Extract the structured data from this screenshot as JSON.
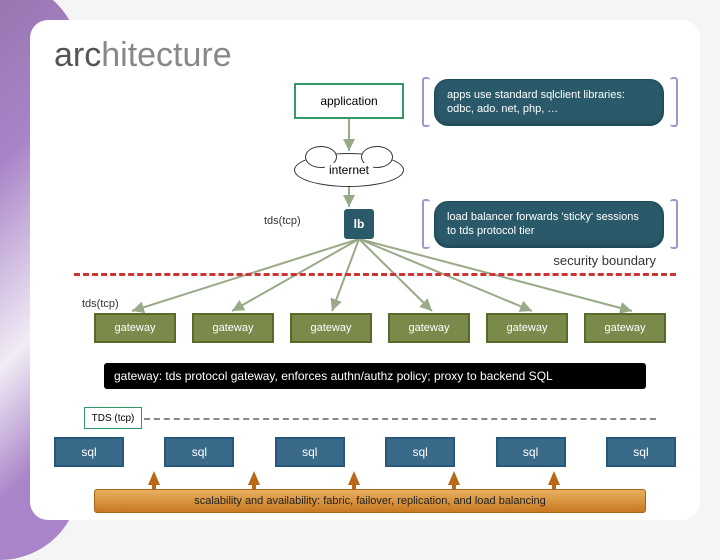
{
  "title": {
    "accent": "arc",
    "rest": "hitecture"
  },
  "app": {
    "label": "application"
  },
  "notes": {
    "apps": "apps use standard sqlclient libraries: odbc, ado. net, php, …",
    "lb": "load balancer forwards 'sticky' sessions to tds protocol tier"
  },
  "cloud": {
    "label": "internet"
  },
  "lb": {
    "label": "lb"
  },
  "tds_labels": {
    "l1": "tds(tcp)",
    "l2": "tds(tcp)",
    "l3": "TDS (tcp)"
  },
  "security": {
    "label": "security boundary"
  },
  "gateway": {
    "items": [
      "gateway",
      "gateway",
      "gateway",
      "gateway",
      "gateway",
      "gateway"
    ],
    "desc": "gateway: tds protocol gateway, enforces authn/authz policy; proxy to backend SQL"
  },
  "sql": {
    "items": [
      "sql",
      "sql",
      "sql",
      "sql",
      "sql",
      "sql"
    ]
  },
  "bar": {
    "label": "scalability and availability: fabric, failover, replication, and  load balancing"
  },
  "chart_data": {
    "type": "diagram",
    "title": "architecture",
    "nodes": [
      {
        "id": "application",
        "label": "application",
        "tier": "client"
      },
      {
        "id": "internet",
        "label": "internet",
        "tier": "network"
      },
      {
        "id": "lb",
        "label": "lb",
        "tier": "load-balancer",
        "note": "load balancer forwards 'sticky' sessions to tds protocol tier"
      },
      {
        "id": "gateway",
        "label": "gateway",
        "count": 6,
        "tier": "gateway",
        "desc": "tds protocol gateway, enforces authn/authz policy; proxy to backend SQL"
      },
      {
        "id": "sql",
        "label": "sql",
        "count": 6,
        "tier": "backend"
      }
    ],
    "edges": [
      {
        "from": "application",
        "to": "internet",
        "protocol": ""
      },
      {
        "from": "internet",
        "to": "lb",
        "protocol": "tds(tcp)"
      },
      {
        "from": "lb",
        "to": "gateway",
        "protocol": "tds(tcp)",
        "fanout": true
      },
      {
        "from": "gateway",
        "to": "sql",
        "protocol": "TDS (tcp)"
      }
    ],
    "boundaries": [
      {
        "name": "security boundary",
        "between": [
          "lb",
          "gateway"
        ]
      }
    ],
    "annotations": [
      "apps use standard sqlclient libraries: odbc, ado. net, php, …",
      "scalability and availability: fabric, failover, replication, and load balancing"
    ]
  }
}
